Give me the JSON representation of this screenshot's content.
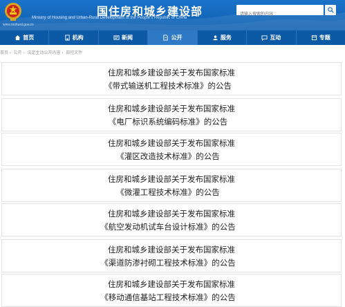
{
  "header": {
    "title": "国住房和城乡建设部",
    "subtitle": "Ministry of Housing and Urban-Rural Development of the People's Republic of China",
    "domain": "www.mohurd.gov.cn",
    "search_placeholder": "请输入搜索的内容",
    "colors": {
      "header_bg": "#1a73c9",
      "nav_bg": "#0c5aa6",
      "nav_active": "#2e7ac7"
    }
  },
  "nav": [
    {
      "label": "首页",
      "icon": "home-icon"
    },
    {
      "label": "机构",
      "icon": "building-icon"
    },
    {
      "label": "新闻",
      "icon": "news-icon"
    },
    {
      "label": "公开",
      "icon": "document-icon"
    },
    {
      "label": "服务",
      "icon": "service-icon"
    },
    {
      "label": "互动",
      "icon": "chat-icon"
    },
    {
      "label": "专题",
      "icon": "topic-icon"
    }
  ],
  "breadcrumb": [
    "首页",
    "公开",
    "法定主动公开内容",
    "部控文件"
  ],
  "notices": [
    {
      "line1": "住房和城乡建设部关于发布国家标准",
      "line2": "《带式输送机工程技术标准》的公告"
    },
    {
      "line1": "住房和城乡建设部关于发布国家标准",
      "line2": "《电厂标识系统编码标准》的公告"
    },
    {
      "line1": "住房和城乡建设部关于发布国家标准",
      "line2": "《灌区改造技术标准》的公告"
    },
    {
      "line1": "住房和城乡建设部关于发布国家标准",
      "line2": "《微灌工程技术标准》的公告"
    },
    {
      "line1": "住房和城乡建设部关于发布国家标准",
      "line2": "《航空发动机试车台设计标准》的公告"
    },
    {
      "line1": "住房和城乡建设部关于发布国家标准",
      "line2": "《渠道防渗衬砌工程技术标准》的公告"
    },
    {
      "line1": "住房和城乡建设部关于发布国家标准",
      "line2": "《移动通信基站工程技术标准》的公告"
    }
  ]
}
